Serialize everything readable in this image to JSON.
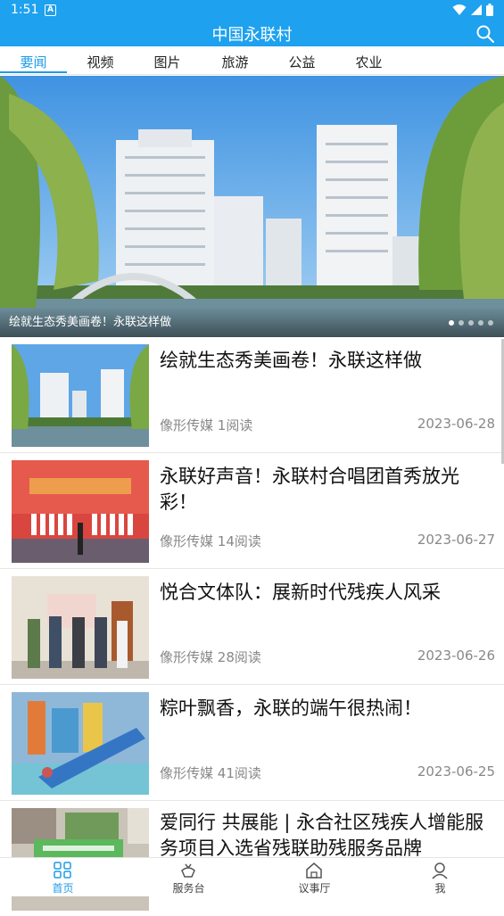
{
  "status_bar": {
    "time": "1:51",
    "notification_letter": "A"
  },
  "app": {
    "title": "中国永联村"
  },
  "tabs": [
    {
      "label": "要闻",
      "active": true
    },
    {
      "label": "视频"
    },
    {
      "label": "图片"
    },
    {
      "label": "旅游"
    },
    {
      "label": "公益"
    },
    {
      "label": "农业"
    }
  ],
  "banner": {
    "caption": "绘就生态秀美画卷！永联这样做",
    "slide_count": 5,
    "active_slide": 1
  },
  "articles": [
    {
      "title": "绘就生态秀美画卷！永联这样做",
      "source": "像形传媒",
      "reads": "1阅读",
      "date": "2023-06-28",
      "thumb": "residential towers by lake"
    },
    {
      "title": "永联好声音！永联村合唱团首秀放光彩！",
      "source": "像形传媒",
      "reads": "14阅读",
      "date": "2023-06-27",
      "thumb": "choir on stage"
    },
    {
      "title": "悦合文体队：展新时代残疾人风采",
      "source": "像形传媒",
      "reads": "28阅读",
      "date": "2023-06-26",
      "thumb": "group holding certificates"
    },
    {
      "title": "粽叶飘香，永联的端午很热闹！",
      "source": "像形传媒",
      "reads": "41阅读",
      "date": "2023-06-25",
      "thumb": "water park slides"
    },
    {
      "title": "爱同行 共展能 | 永合社区残疾人增能服务项目入选省残联助残服务品牌",
      "source": "",
      "reads": "",
      "date": "",
      "thumb": "community event banner"
    }
  ],
  "bottom_nav": [
    {
      "label": "首页",
      "icon": "grid-icon",
      "active": true
    },
    {
      "label": "服务台",
      "icon": "service-icon"
    },
    {
      "label": "议事厅",
      "icon": "home-icon"
    },
    {
      "label": "我",
      "icon": "user-icon"
    }
  ],
  "colors": {
    "primary": "#1ea1ee",
    "tab_active": "#1e9be6",
    "meta_text": "#888888"
  }
}
